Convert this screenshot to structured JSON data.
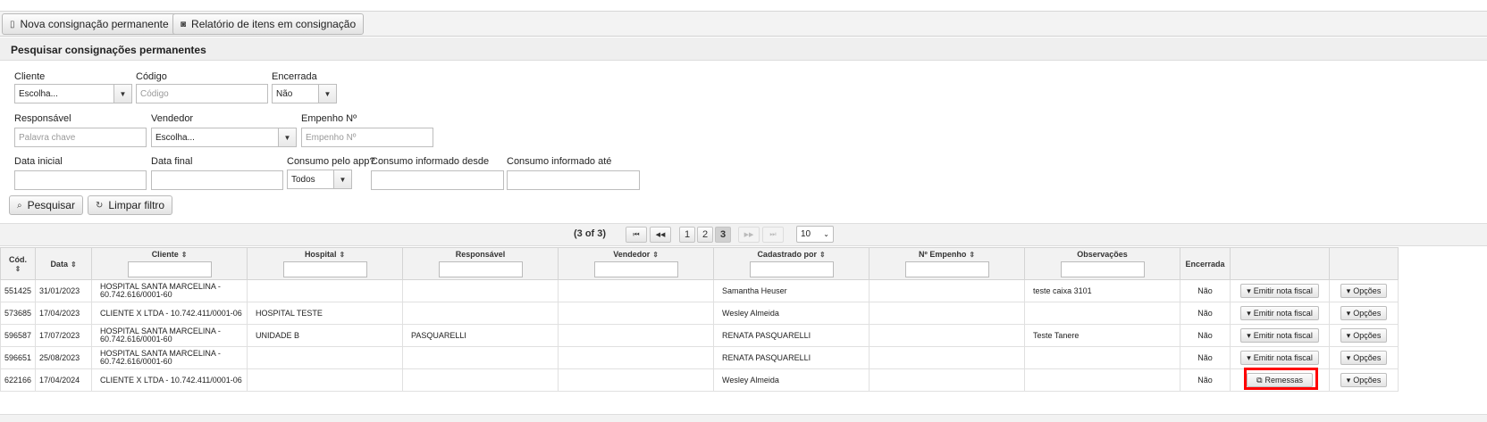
{
  "toolbar": {
    "new_label": "Nova consignação permanente",
    "report_label": "Relatório de itens em consignação"
  },
  "panel": {
    "title": "Pesquisar consignações permanentes"
  },
  "filters": {
    "cliente": {
      "label": "Cliente",
      "value": "Escolha..."
    },
    "codigo": {
      "label": "Código",
      "placeholder": "Código"
    },
    "encerrada": {
      "label": "Encerrada",
      "value": "Não"
    },
    "responsavel": {
      "label": "Responsável",
      "placeholder": "Palavra chave"
    },
    "vendedor": {
      "label": "Vendedor",
      "value": "Escolha..."
    },
    "empenho": {
      "label": "Empenho Nº",
      "placeholder": "Empenho Nº"
    },
    "data_inicial": {
      "label": "Data inicial"
    },
    "data_final": {
      "label": "Data final"
    },
    "consumo_app": {
      "label": "Consumo pelo app?",
      "value": "Todos"
    },
    "consumo_desde": {
      "label": "Consumo informado desde"
    },
    "consumo_ate": {
      "label": "Consumo informado até"
    },
    "search_label": "Pesquisar",
    "clear_label": "Limpar filtro"
  },
  "pager": {
    "summary": "(3 of 3)",
    "first": "⏮",
    "prev": "◀◀",
    "pages": [
      "1",
      "2",
      "3"
    ],
    "current_page": "3",
    "next": "▶▶",
    "last": "⏭",
    "rows_per_page": "10"
  },
  "table": {
    "headers": {
      "cod": "Cód.",
      "data": "Data",
      "cliente": "Cliente",
      "hospital": "Hospital",
      "responsavel": "Responsável",
      "vendedor": "Vendedor",
      "cadastrado": "Cadastrado por",
      "empenho": "Nº Empenho",
      "observacoes": "Observações",
      "encerrada": "Encerrada"
    },
    "rows": [
      {
        "cod": "551425",
        "data": "31/01/2023",
        "cliente": "HOSPITAL SANTA MARCELINA - 60.742.616/0001-60",
        "hospital": "",
        "responsavel": "",
        "vendedor": "",
        "cadastrado": "Samantha Heuser",
        "empenho": "",
        "obs": "teste caixa 3101",
        "encerrada": "Não",
        "action": "Emitir nota fiscal",
        "options": "Opções"
      },
      {
        "cod": "573685",
        "data": "17/04/2023",
        "cliente": "CLIENTE X LTDA - 10.742.411/0001-06",
        "hospital": "HOSPITAL TESTE",
        "responsavel": "",
        "vendedor": "",
        "cadastrado": "Wesley Almeida",
        "empenho": "",
        "obs": "",
        "encerrada": "Não",
        "action": "Emitir nota fiscal",
        "options": "Opções"
      },
      {
        "cod": "596587",
        "data": "17/07/2023",
        "cliente": "HOSPITAL SANTA MARCELINA - 60.742.616/0001-60",
        "hospital": "UNIDADE B",
        "responsavel": "PASQUARELLI",
        "vendedor": "",
        "cadastrado": "RENATA PASQUARELLI",
        "empenho": "",
        "obs": "Teste Tanere",
        "encerrada": "Não",
        "action": "Emitir nota fiscal",
        "options": "Opções"
      },
      {
        "cod": "596651",
        "data": "25/08/2023",
        "cliente": "HOSPITAL SANTA MARCELINA - 60.742.616/0001-60",
        "hospital": "",
        "responsavel": "",
        "vendedor": "",
        "cadastrado": "RENATA PASQUARELLI",
        "empenho": "",
        "obs": "",
        "encerrada": "Não",
        "action": "Emitir nota fiscal",
        "options": "Opções"
      },
      {
        "cod": "622166",
        "data": "17/04/2024",
        "cliente": "CLIENTE X LTDA - 10.742.411/0001-06",
        "hospital": "",
        "responsavel": "",
        "vendedor": "",
        "cadastrado": "Wesley Almeida",
        "empenho": "",
        "obs": "",
        "encerrada": "Não",
        "action": "Remessas",
        "options": "Opções"
      }
    ]
  }
}
